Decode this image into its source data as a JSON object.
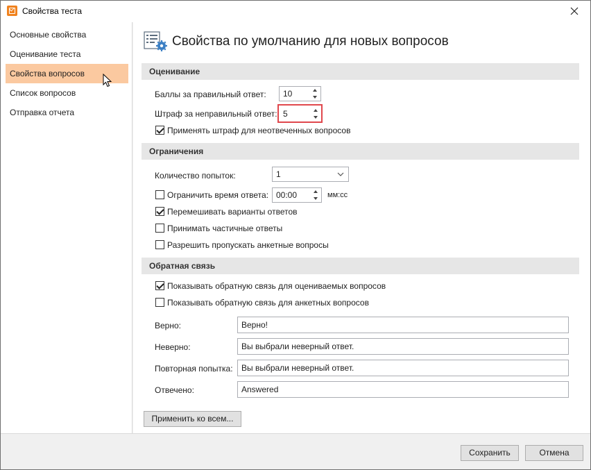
{
  "window": {
    "title": "Свойства теста"
  },
  "sidebar": {
    "items": [
      {
        "label": "Основные свойства"
      },
      {
        "label": "Оценивание теста"
      },
      {
        "label": "Свойства вопросов"
      },
      {
        "label": "Список вопросов"
      },
      {
        "label": "Отправка отчета"
      }
    ]
  },
  "main": {
    "title": "Свойства по умолчанию для новых вопросов",
    "scoring": {
      "header": "Оценивание",
      "correct_points_label": "Баллы за правильный ответ:",
      "correct_points_value": "10",
      "penalty_label": "Штраф за неправильный ответ:",
      "penalty_value": "5",
      "apply_penalty_label": "Применять штраф для неотвеченных вопросов"
    },
    "limits": {
      "header": "Ограничения",
      "attempts_label": "Количество попыток:",
      "attempts_value": "1",
      "limit_time_label": "Ограничить время ответа:",
      "time_value": "00:00",
      "time_unit": "мм:сс",
      "shuffle_label": "Перемешивать варианты ответов",
      "partial_label": "Принимать частичные ответы",
      "skip_survey_label": "Разрешить пропускать анкетные вопросы"
    },
    "feedback": {
      "header": "Обратная связь",
      "show_graded_label": "Показывать обратную связь для оцениваемых вопросов",
      "show_survey_label": "Показывать обратную связь для анкетных вопросов",
      "correct_label": "Верно:",
      "correct_value": "Верно!",
      "incorrect_label": "Неверно:",
      "incorrect_value": "Вы выбрали неверный ответ.",
      "retry_label": "Повторная попытка:",
      "retry_value": "Вы выбрали неверный ответ.",
      "answered_label": "Отвечено:",
      "answered_value": "Answered"
    },
    "apply_all_label": "Применить ко всем..."
  },
  "footer": {
    "save_label": "Сохранить",
    "cancel_label": "Отмена"
  },
  "colors": {
    "accent": "#f0821e",
    "selected_nav": "#fbc9a0",
    "highlight_border": "#e0474c"
  }
}
